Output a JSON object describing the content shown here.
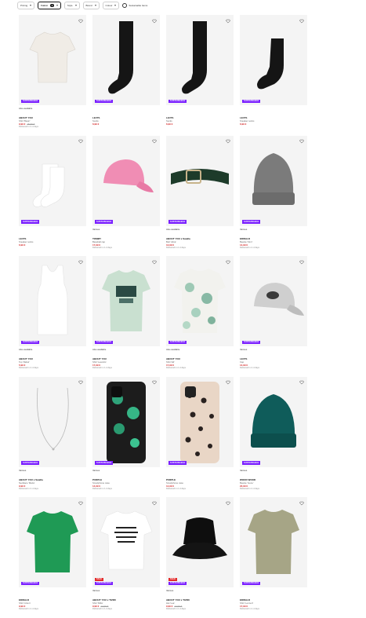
{
  "filters": [
    {
      "label": "Pricing",
      "active": false
    },
    {
      "label": "Fabric",
      "count": "1",
      "active": true
    },
    {
      "label": "Style",
      "active": false
    },
    {
      "label": "Brand",
      "active": false
    },
    {
      "label": "Colour",
      "active": false
    }
  ],
  "toggle_label": "Sustainable Items",
  "colors": {
    "badge": "#7a1fff",
    "sale": "#d32525",
    "badge_red": "#e32b2b"
  },
  "products": [
    {
      "badge": "SUSTAINABLE",
      "availability": "Also available",
      "brand": "ABOUT YOU",
      "title": "Shirt 'Basic'",
      "price": "9,99 €",
      "old_price": "15,99 €",
      "meta": "Delivered in 2–4 days"
    },
    {
      "badge": "SUSTAINABLE",
      "availability": "",
      "brand": "LEVI'S",
      "title": "Socks",
      "price": "6,99 €",
      "old_price": "",
      "meta": ""
    },
    {
      "badge": "SUSTAINABLE",
      "availability": "",
      "brand": "LEVI'S",
      "title": "Socks",
      "price": "6,99 €",
      "old_price": "",
      "meta": ""
    },
    {
      "badge": "SUSTAINABLE",
      "availability": "",
      "brand": "LEVI'S",
      "title": "Sneaker socks",
      "price": "6,99 €",
      "old_price": "",
      "meta": ""
    },
    {
      "badge": "SUSTAINABLE",
      "availability": "",
      "brand": "LEVI'S",
      "title": "Sneaker socks",
      "price": "6,99 €",
      "old_price": "",
      "meta": ""
    },
    {
      "badge": "SUSTAINABLE",
      "availability": "Various",
      "brand": "TOMMY",
      "title": "Baseball cap",
      "price": "17,99 €",
      "old_price": "",
      "meta": "Delivered in 2–4 days"
    },
    {
      "badge": "SUSTAINABLE",
      "availability": "Also available",
      "brand": "ABOUT YOU x Swalla",
      "title": "Belt 'Alina'",
      "price": "12,99 €",
      "old_price": "",
      "meta": "Delivered in 2–4 days"
    },
    {
      "badge": "SUSTAINABLE",
      "availability": "Various",
      "brand": "EDWALD",
      "title": "Beanie 'Kimi'",
      "price": "14,99 €",
      "old_price": "",
      "meta": "Delivered in 2–4 days"
    },
    {
      "badge": "SUSTAINABLE",
      "availability": "Also available",
      "brand": "ABOUT YOU",
      "title": "Top 'Rahel'",
      "price": "5,99 €",
      "old_price": "",
      "meta": "Delivered in 2–4 days"
    },
    {
      "badge": "SUSTAINABLE",
      "availability": "Also available",
      "brand": "ABOUT YOU",
      "title": "Shirt 'Leandro'",
      "price": "17,99 €",
      "old_price": "",
      "meta": "Delivered in 2–4 days"
    },
    {
      "badge": "SUSTAINABLE",
      "availability": "Also available",
      "brand": "ABOUT YOU",
      "title": "Shirt 'Eli'",
      "price": "17,99 €",
      "old_price": "",
      "meta": "Delivered in 2–4 days"
    },
    {
      "badge": "SUSTAINABLE",
      "availability": "Various",
      "brand": "LEVI'S",
      "title": "Cap",
      "price": "14,99 €",
      "old_price": "",
      "meta": "Delivered in 2–4 days"
    },
    {
      "badge": "SUSTAINABLE",
      "availability": "Various",
      "brand": "ABOUT YOU x Swalla",
      "title": "Necklace 'Maria'",
      "price": "9,99 €",
      "old_price": "",
      "meta": "Delivered in 2–4 days"
    },
    {
      "badge": "SUSTAINABLE",
      "availability": "Various",
      "brand": "PURPLE",
      "title": "Smartphone case",
      "price": "14,99 €",
      "old_price": "",
      "meta": "Delivered in 2–4 days"
    },
    {
      "badge": "SUSTAINABLE",
      "availability": "",
      "brand": "PURPLE",
      "title": "Smartphone case",
      "price": "14,99 €",
      "old_price": "",
      "meta": "Delivered in 2–4 days"
    },
    {
      "badge": "SUSTAINABLE",
      "availability": "Various",
      "brand": "WOOD WOOD",
      "title": "Beanie 'Gene'",
      "price": "22,99 €",
      "old_price": "",
      "meta": "Delivered in 2–4 days"
    },
    {
      "badge": "SUSTAINABLE",
      "availability": "",
      "brand": "EDWALD",
      "title": "Shirt 'Anton'",
      "price": "9,99 €",
      "old_price": "",
      "meta": "Delivered in 2–4 days"
    },
    {
      "badge": "SUSTAINABLE",
      "badge2": "SALE",
      "availability": "Various",
      "brand": "ABOUT YOU x TIZIRI",
      "title": "Shirt 'Milla'",
      "price": "9,99 €",
      "old_price": "12,99 €",
      "meta": "Delivered in 2–4 days"
    },
    {
      "badge": "SUSTAINABLE",
      "badge2": "SALE",
      "availability": "Various",
      "brand": "ABOUT YOU x TIZIRI",
      "title": "Hat 'Lea'",
      "price": "9,99 €",
      "old_price": "12,99 €",
      "meta": "Delivered in 2–4 days"
    },
    {
      "badge": "SUSTAINABLE",
      "availability": "",
      "brand": "EDWALD",
      "title": "Shirt 'Lennert'",
      "price": "17,99 €",
      "old_price": "",
      "meta": "Delivered in 2–4 days"
    }
  ]
}
